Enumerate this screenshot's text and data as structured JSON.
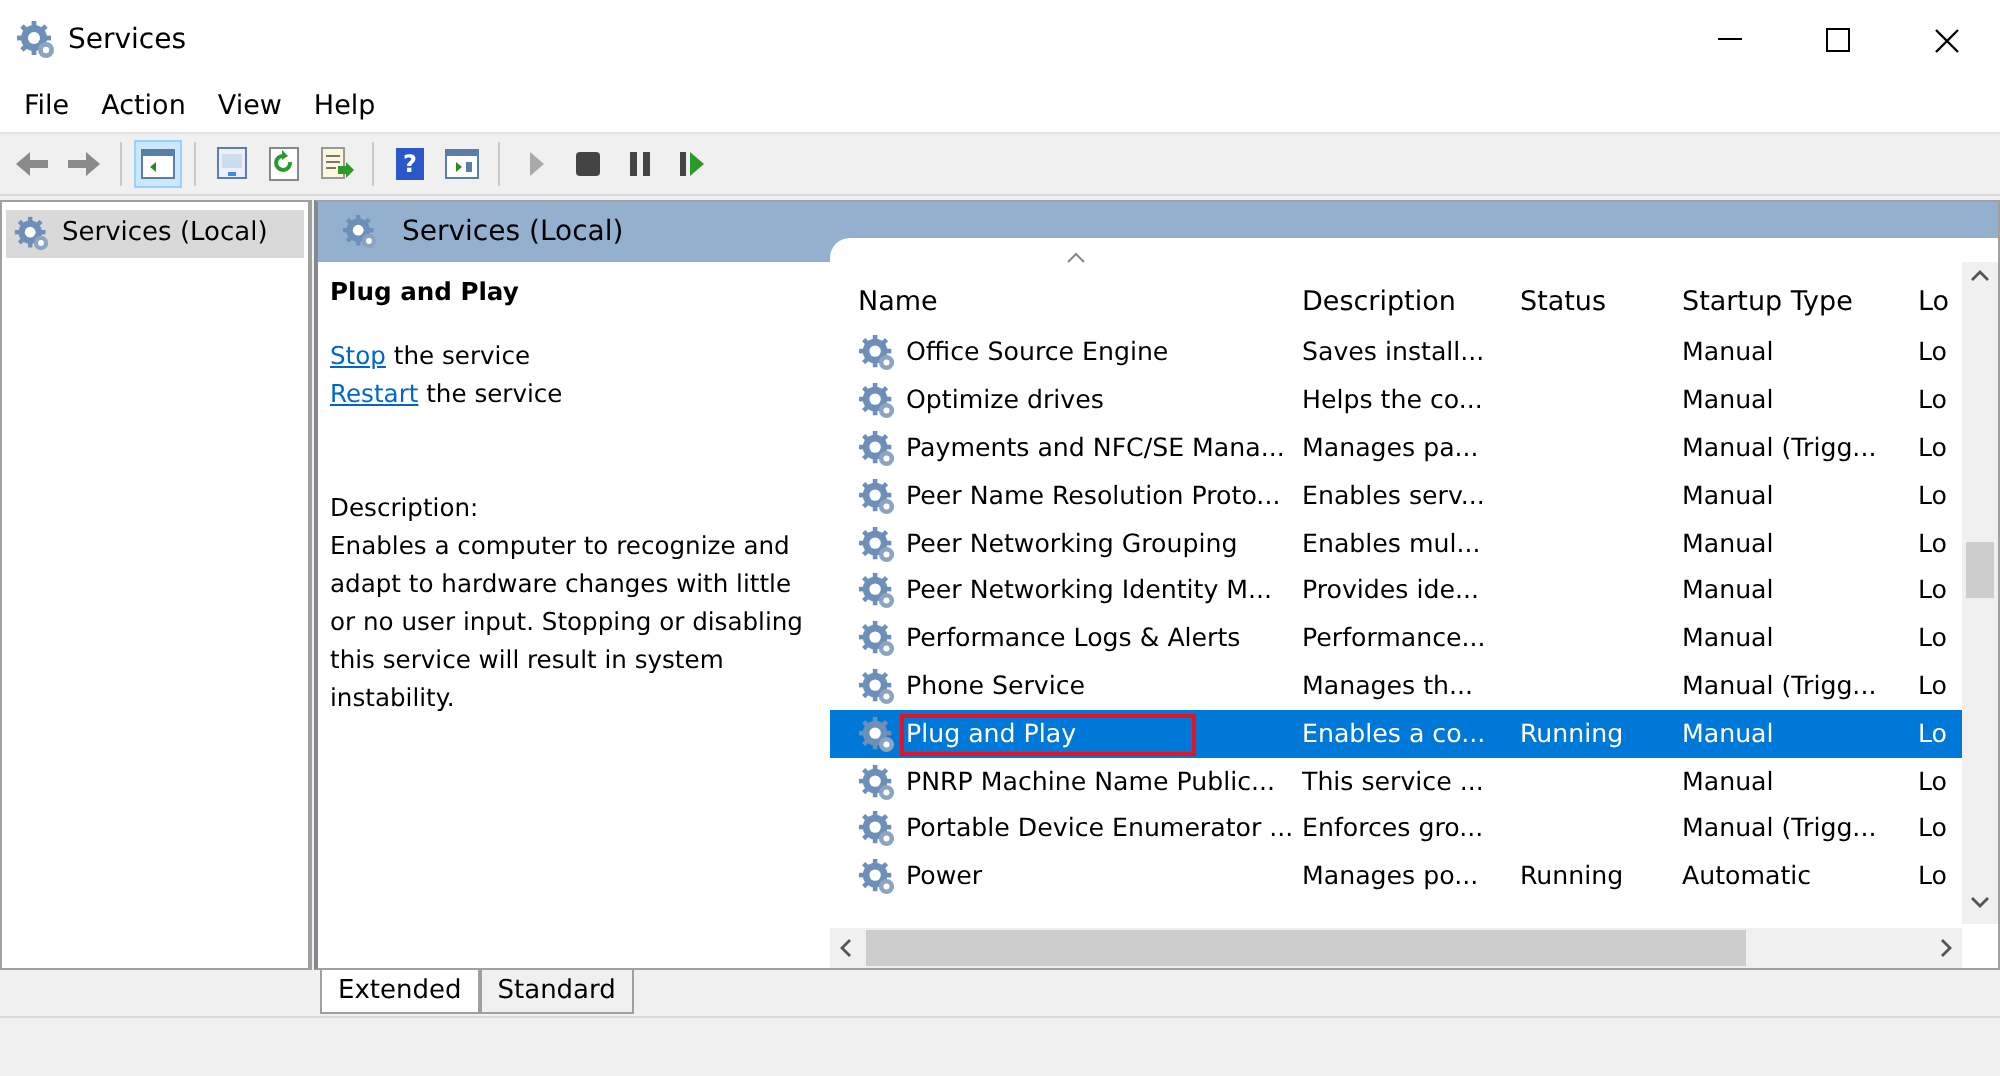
{
  "window": {
    "title": "Services"
  },
  "menu": [
    "File",
    "Action",
    "View",
    "Help"
  ],
  "toolbar": [
    {
      "kind": "back",
      "selected": false
    },
    {
      "kind": "forward",
      "selected": false
    },
    {
      "kind": "sep"
    },
    {
      "kind": "panel",
      "selected": true
    },
    {
      "kind": "sep"
    },
    {
      "kind": "properties",
      "selected": false
    },
    {
      "kind": "refresh",
      "selected": false
    },
    {
      "kind": "export",
      "selected": false
    },
    {
      "kind": "sep"
    },
    {
      "kind": "help",
      "label": "?",
      "selected": false
    },
    {
      "kind": "panel2",
      "selected": false
    },
    {
      "kind": "sep"
    },
    {
      "kind": "play",
      "selected": false,
      "disabled": true
    },
    {
      "kind": "stop",
      "selected": false,
      "disabled": false
    },
    {
      "kind": "pause",
      "selected": false,
      "disabled": false
    },
    {
      "kind": "resume",
      "selected": false,
      "disabled": false
    }
  ],
  "tree": [
    {
      "label": "Services (Local)",
      "selected": true
    }
  ],
  "pane": {
    "title": "Services (Local)",
    "service_name": "Plug and Play",
    "actions": [
      {
        "link": "Stop",
        "text": " the service"
      },
      {
        "link": "Restart",
        "text": " the service"
      }
    ],
    "description_label": "Description:",
    "description": "Enables a computer to recognize and adapt to hardware changes with little or no user input. Stopping or disabling this service will result in system instability."
  },
  "table": {
    "columns": [
      "Name",
      "Description",
      "Status",
      "Startup Type",
      "Lo"
    ],
    "rows": [
      {
        "cells": [
          "Office  Source Engine",
          "Saves install...",
          "",
          "Manual",
          "Lo"
        ],
        "selected": false,
        "outlined": false
      },
      {
        "cells": [
          "Optimize drives",
          "Helps the co...",
          "",
          "Manual",
          "Lo"
        ],
        "selected": false,
        "outlined": false
      },
      {
        "cells": [
          "Payments and NFC/SE Mana...",
          "Manages pa...",
          "",
          "Manual (Trigg...",
          "Lo"
        ],
        "selected": false,
        "outlined": false
      },
      {
        "cells": [
          "Peer Name Resolution Proto...",
          "Enables serv...",
          "",
          "Manual",
          "Lo"
        ],
        "selected": false,
        "outlined": false
      },
      {
        "cells": [
          "Peer Networking Grouping",
          "Enables mul...",
          "",
          "Manual",
          "Lo"
        ],
        "selected": false,
        "outlined": false
      },
      {
        "cells": [
          "Peer Networking Identity M...",
          "Provides ide...",
          "",
          "Manual",
          "Lo"
        ],
        "selected": false,
        "outlined": false
      },
      {
        "cells": [
          "Performance Logs & Alerts",
          "Performance...",
          "",
          "Manual",
          "Lo"
        ],
        "selected": false,
        "outlined": false
      },
      {
        "cells": [
          "Phone Service",
          "Manages th...",
          "",
          "Manual (Trigg...",
          "Lo"
        ],
        "selected": false,
        "outlined": false
      },
      {
        "cells": [
          "Plug and Play",
          "Enables a co...",
          "Running",
          "Manual",
          "Lo"
        ],
        "selected": true,
        "outlined": true
      },
      {
        "cells": [
          "PNRP Machine Name Public...",
          "This service ...",
          "",
          "Manual",
          "Lo"
        ],
        "selected": false,
        "outlined": false
      },
      {
        "cells": [
          "Portable Device Enumerator ...",
          "Enforces gro...",
          "",
          "Manual (Trigg...",
          "Lo"
        ],
        "selected": false,
        "outlined": false
      },
      {
        "cells": [
          "Power",
          "Manages po...",
          "Running",
          "Automatic",
          "Lo"
        ],
        "selected": false,
        "outlined": false
      }
    ]
  },
  "view_tabs": [
    {
      "label": "Extended",
      "selected": true
    },
    {
      "label": "Standard",
      "selected": false
    }
  ]
}
